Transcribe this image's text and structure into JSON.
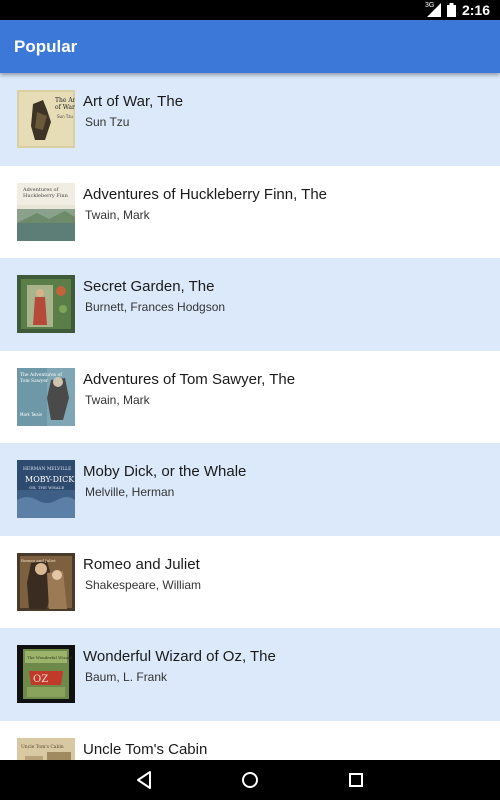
{
  "status_bar": {
    "network": "3G",
    "time": "2:16"
  },
  "app_bar": {
    "title": "Popular"
  },
  "books": [
    {
      "title": "Art of War, The",
      "author": "Sun Tzu",
      "cover_icon": "art-of-war-cover"
    },
    {
      "title": "Adventures of Huckleberry Finn, The",
      "author": "Twain, Mark",
      "cover_icon": "huckleberry-finn-cover"
    },
    {
      "title": "Secret Garden, The",
      "author": "Burnett, Frances Hodgson",
      "cover_icon": "secret-garden-cover"
    },
    {
      "title": "Adventures of Tom Sawyer, The",
      "author": "Twain, Mark",
      "cover_icon": "tom-sawyer-cover"
    },
    {
      "title": "Moby Dick, or the Whale",
      "author": "Melville, Herman",
      "cover_icon": "moby-dick-cover"
    },
    {
      "title": "Romeo and Juliet",
      "author": "Shakespeare, William",
      "cover_icon": "romeo-juliet-cover"
    },
    {
      "title": "Wonderful Wizard of Oz, The",
      "author": "Baum, L. Frank",
      "cover_icon": "wizard-of-oz-cover"
    },
    {
      "title": "Uncle Tom's Cabin",
      "author": "",
      "cover_icon": "uncle-toms-cabin-cover"
    }
  ],
  "nav_bar": {
    "back_icon": "back-icon",
    "home_icon": "home-icon",
    "recents_icon": "recents-icon"
  },
  "colors": {
    "app_bar": "#3b78d8",
    "shaded_row": "#dce9fb",
    "plain_row": "#ffffff"
  }
}
